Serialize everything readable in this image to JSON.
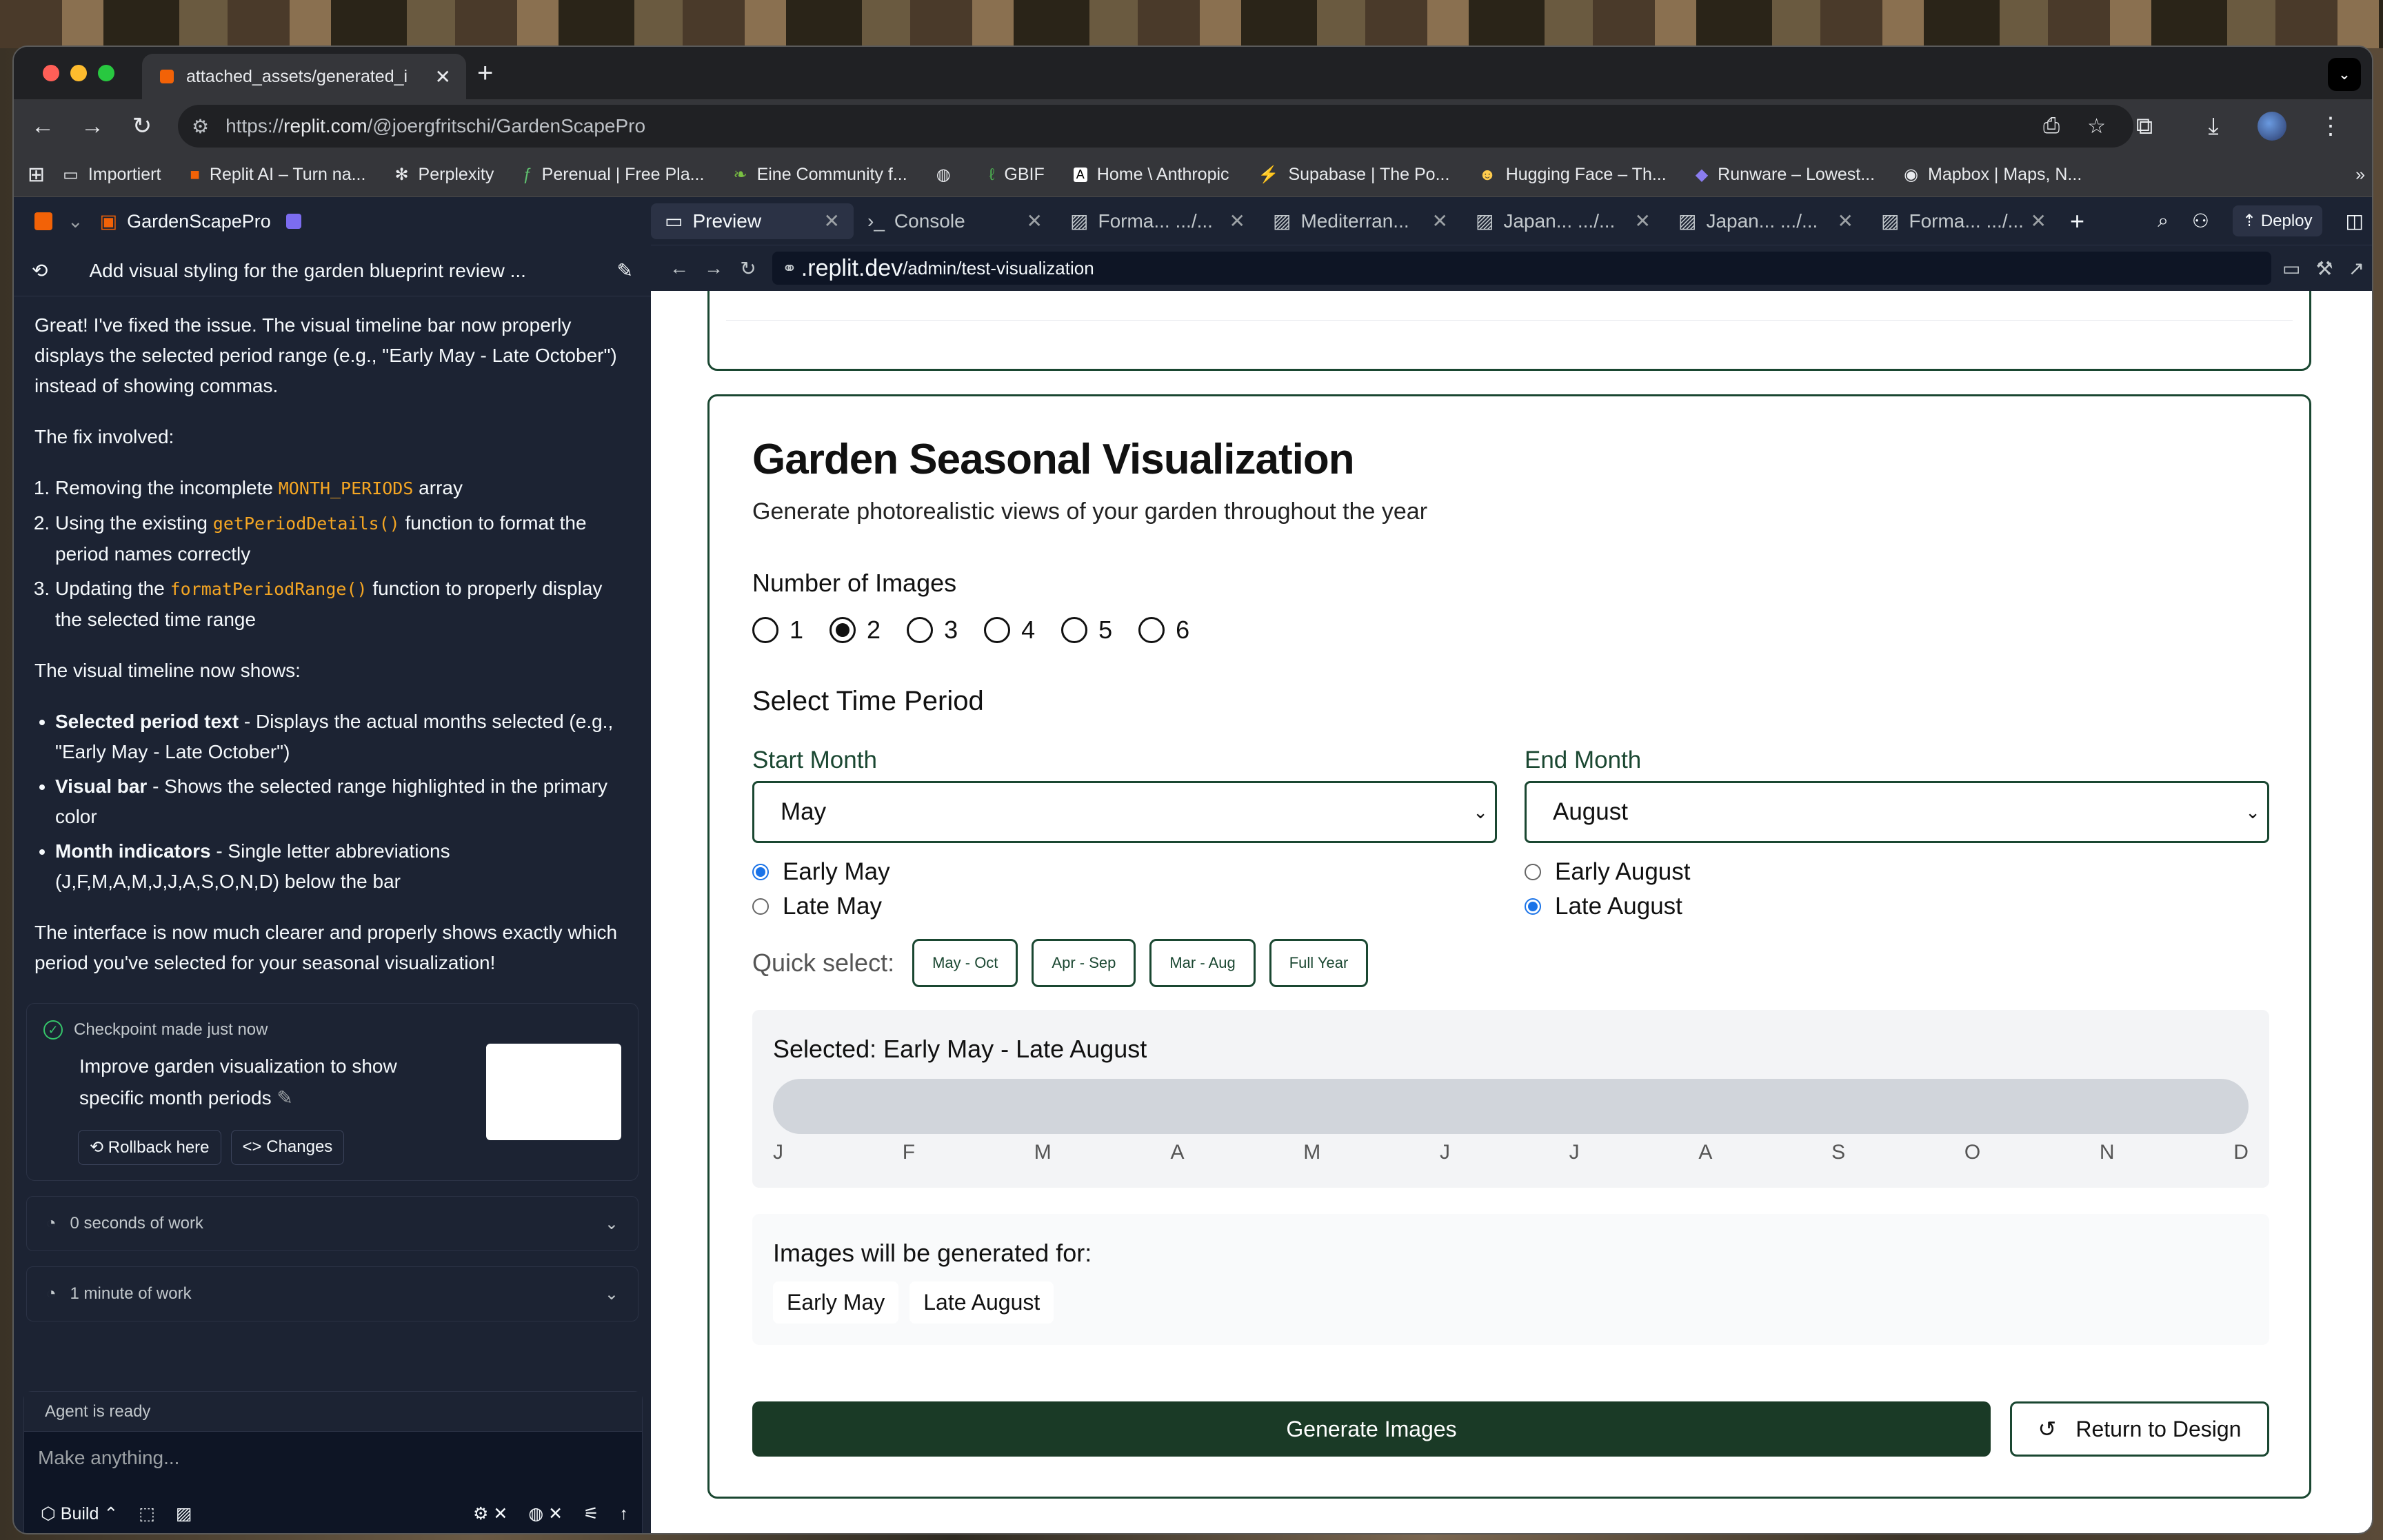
{
  "browser": {
    "tab_title": "attached_assets/generated_i",
    "url_prefix": "https://",
    "url_domain": "replit.com",
    "url_path": "/@joergfritschi/GardenScapePro",
    "bookmarks": [
      {
        "icon": "folder-icon",
        "label": "Importiert"
      },
      {
        "icon": "replit-icon",
        "label": "Replit AI – Turn na..."
      },
      {
        "icon": "perplexity-icon",
        "label": "Perplexity"
      },
      {
        "icon": "perenual-icon",
        "label": "Perenual | Free Pla..."
      },
      {
        "icon": "leaf-icon",
        "label": "Eine Community f..."
      },
      {
        "icon": "globe-icon",
        "label": ""
      },
      {
        "icon": "gbif-icon",
        "label": "GBIF"
      },
      {
        "icon": "anthropic-icon",
        "label": "Home \\ Anthropic"
      },
      {
        "icon": "supabase-icon",
        "label": "Supabase | The Po..."
      },
      {
        "icon": "huggingface-icon",
        "label": "Hugging Face – Th..."
      },
      {
        "icon": "runware-icon",
        "label": "Runware – Lowest..."
      },
      {
        "icon": "mapbox-icon",
        "label": "Mapbox | Maps, N..."
      }
    ]
  },
  "replit": {
    "project_name": "GardenScapePro",
    "thread_title": "Add visual styling for the garden blueprint review ...",
    "chat": {
      "p1": "Great! I've fixed the issue. The visual timeline bar now properly displays the selected period range (e.g., \"Early May - Late October\") instead of showing commas.",
      "p2": "The fix involved:",
      "steps": [
        {
          "pre": "Removing the incomplete ",
          "code": "MONTH_PERIODS",
          "post": " array"
        },
        {
          "pre": "Using the existing ",
          "code": "getPeriodDetails()",
          "post": " function to format the period names correctly"
        },
        {
          "pre": "Updating the ",
          "code": "formatPeriodRange()",
          "post": " function to properly display the selected time range"
        }
      ],
      "p3": "The visual timeline now shows:",
      "bullets": [
        {
          "b": "Selected period text",
          "t": " - Displays the actual months selected (e.g., \"Early May - Late October\")"
        },
        {
          "b": "Visual bar",
          "t": " - Shows the selected range highlighted in the primary color"
        },
        {
          "b": "Month indicators",
          "t": " - Single letter abbreviations (J,F,M,A,M,J,J,A,S,O,N,D) below the bar"
        }
      ],
      "p4": "The interface is now much clearer and properly shows exactly which period you've selected for your seasonal visualization!"
    },
    "checkpoint": {
      "header": "Checkpoint made just now",
      "desc": "Improve garden visualization to show specific month periods",
      "rollback": "Rollback here",
      "changes": "Changes"
    },
    "work1": "0 seconds of work",
    "work2": "1 minute of work",
    "agent_status": "Agent is ready",
    "agent_placeholder": "Make anything...",
    "build_label": "Build",
    "workspace_tabs": [
      {
        "icon": "monitor-icon",
        "label": "Preview"
      },
      {
        "icon": "terminal-icon",
        "label": "Console"
      },
      {
        "icon": "image-icon",
        "label": "Forma...   .../..."
      },
      {
        "icon": "image-icon",
        "label": "Mediterran..."
      },
      {
        "icon": "image-icon",
        "label": "Japan...   .../..."
      },
      {
        "icon": "image-icon",
        "label": "Japan...   .../..."
      },
      {
        "icon": "image-icon",
        "label": "Forma...   .../..."
      }
    ],
    "deploy_label": "Deploy",
    "preview_domain": ".replit.dev",
    "preview_path": "/admin/test-visualization"
  },
  "app": {
    "title": "Garden Seasonal Visualization",
    "subtitle": "Generate photorealistic views of your garden throughout the year",
    "num_images_label": "Number of Images",
    "num_options": [
      "1",
      "2",
      "3",
      "4",
      "5",
      "6"
    ],
    "num_selected": "2",
    "time_period_label": "Select Time Period",
    "start_label": "Start Month",
    "start_value": "May",
    "start_early": "Early May",
    "start_late": "Late May",
    "end_label": "End Month",
    "end_value": "August",
    "end_early": "Early August",
    "end_late": "Late August",
    "quick_label": "Quick select:",
    "quick_options": [
      "May - Oct",
      "Apr - Sep",
      "Mar - Aug",
      "Full Year"
    ],
    "selected_text": "Selected: Early May - Late August",
    "months": [
      "J",
      "F",
      "M",
      "A",
      "M",
      "J",
      "J",
      "A",
      "S",
      "O",
      "N",
      "D"
    ],
    "gen_for_label": "Images will be generated for:",
    "gen_chips": [
      "Early May",
      "Late August"
    ],
    "generate_btn": "Generate Images",
    "return_btn": "Return to Design"
  }
}
